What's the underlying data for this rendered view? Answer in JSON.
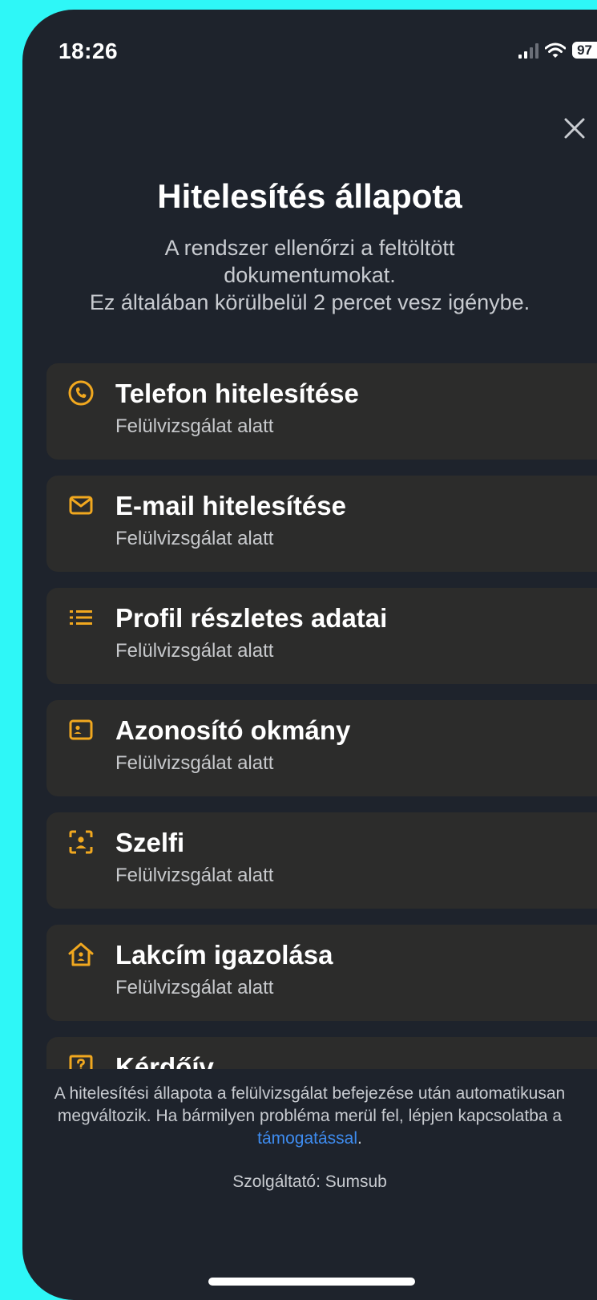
{
  "status_bar": {
    "time": "18:26",
    "battery": "97"
  },
  "header": {
    "title": "Hitelesítés állapota",
    "subtitle": "A rendszer ellenőrzi a feltöltött\ndokumentumokat.\nEz általában körülbelül 2 percet vesz igénybe."
  },
  "accent_color": "#f1a81f",
  "steps": [
    {
      "title": "Telefon hitelesítése",
      "status": "Felülvizsgálat alatt",
      "icon": "phone-icon"
    },
    {
      "title": "E-mail hitelesítése",
      "status": "Felülvizsgálat alatt",
      "icon": "mail-icon"
    },
    {
      "title": "Profil részletes adatai",
      "status": "Felülvizsgálat alatt",
      "icon": "list-icon"
    },
    {
      "title": "Azonosító okmány",
      "status": "Felülvizsgálat alatt",
      "icon": "id-card-icon"
    },
    {
      "title": "Szelfi",
      "status": "Felülvizsgálat alatt",
      "icon": "selfie-icon"
    },
    {
      "title": "Lakcím igazolása",
      "status": "Felülvizsgálat alatt",
      "icon": "home-icon"
    },
    {
      "title": "Kérdőív",
      "status": "",
      "icon": "questionnaire-icon"
    }
  ],
  "footer": {
    "note_before": "A hitelesítési állapota a felülvizsgálat befejezése után automatikusan megváltozik. Ha bármilyen probléma merül fel, lépjen kapcsolatba a ",
    "support_link": "támogatással",
    "note_after": ".",
    "provider": "Szolgáltató: Sumsub"
  }
}
